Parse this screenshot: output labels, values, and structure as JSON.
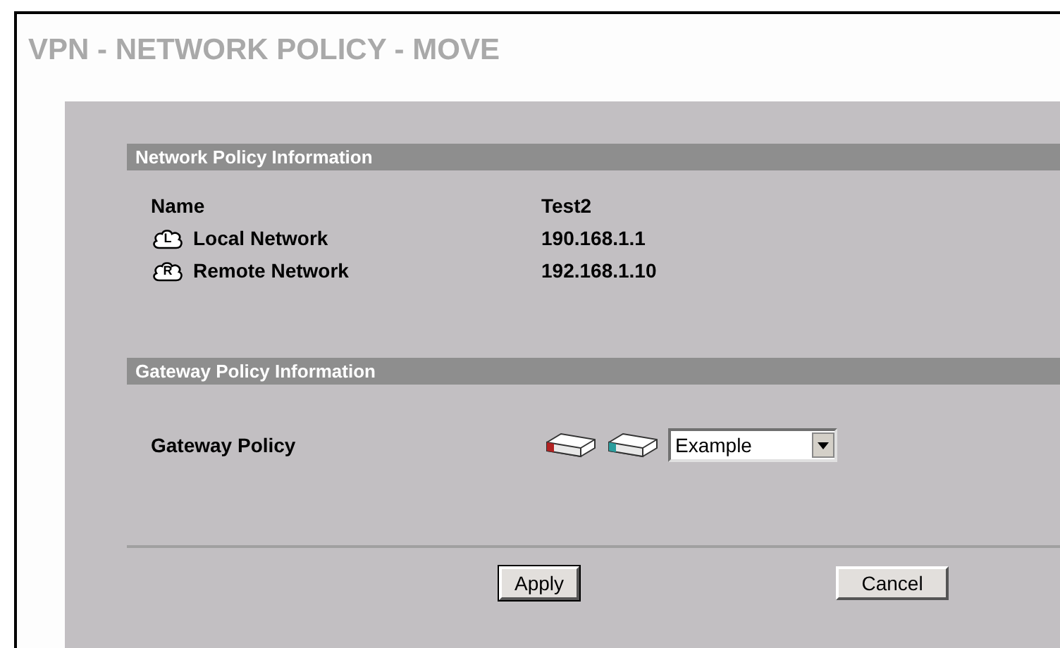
{
  "page_title": "VPN - NETWORK POLICY - MOVE",
  "network_section": {
    "title": "Network Policy Information",
    "rows": [
      {
        "kind": "plain",
        "label": "Name",
        "value": "Test2"
      },
      {
        "kind": "local",
        "icon_letter": "L",
        "label": "Local Network",
        "value": "190.168.1.1"
      },
      {
        "kind": "remote",
        "icon_letter": "R",
        "label": "Remote Network",
        "value": "192.168.1.10"
      }
    ]
  },
  "gateway_section": {
    "title": "Gateway Policy Information",
    "label": "Gateway Policy",
    "select_value": "Example"
  },
  "buttons": [
    {
      "label": "Apply",
      "default": true
    },
    {
      "label": "Cancel",
      "default": false
    }
  ]
}
